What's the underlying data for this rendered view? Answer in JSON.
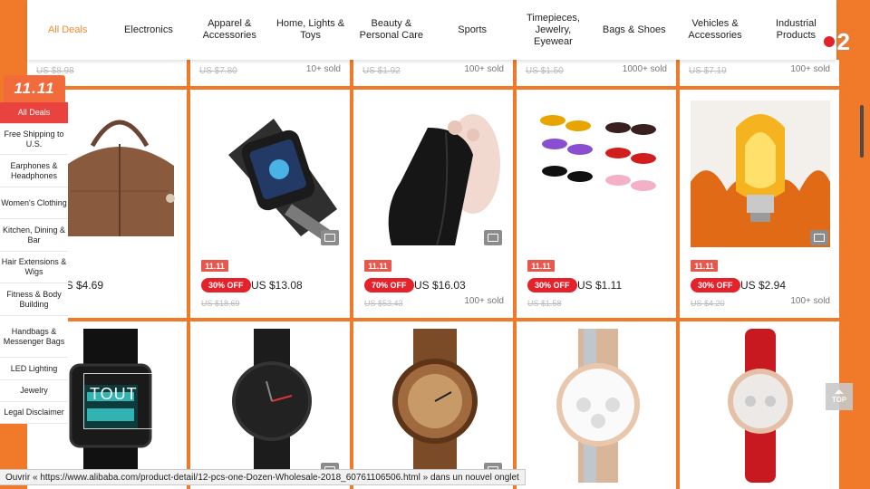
{
  "nav": {
    "items": [
      {
        "label": "All Deals",
        "active": true
      },
      {
        "label": "Electronics"
      },
      {
        "label": "Apparel & Accessories"
      },
      {
        "label": "Home, Lights & Toys"
      },
      {
        "label": "Beauty & Personal Care"
      },
      {
        "label": "Sports"
      },
      {
        "label": "Timepieces, Jewelry, Eyewear"
      },
      {
        "label": "Bags & Shoes"
      },
      {
        "label": "Vehicles & Accessories"
      },
      {
        "label": "Industrial Products"
      }
    ]
  },
  "live_badge": {
    "number": "2",
    "dot_color": "#e4222b"
  },
  "sidebar": {
    "logo": "11.11",
    "items": [
      {
        "label": "All Deals",
        "active": true
      },
      {
        "label": "Free Shipping to U.S."
      },
      {
        "label": "Earphones & Headphones"
      },
      {
        "label": "Women's Clothing"
      },
      {
        "label": "Kitchen, Dining & Bar"
      },
      {
        "label": "Hair Extensions & Wigs"
      },
      {
        "label": "Fitness & Body Building"
      },
      {
        "label": "Handbags & Messenger Bags"
      },
      {
        "label": "LED Lighting"
      },
      {
        "label": "Jewelry"
      },
      {
        "label": "Legal Disclaimer"
      }
    ]
  },
  "top_strip": [
    {
      "old_price": "US $8.98",
      "sold": ""
    },
    {
      "old_price": "US $7.80",
      "sold": "10+ sold"
    },
    {
      "old_price": "US $1.92",
      "sold": "100+ sold"
    },
    {
      "old_price": "US $1.50",
      "sold": "1000+ sold"
    },
    {
      "old_price": "US $7.19",
      "sold": "100+ sold"
    }
  ],
  "products_row1": [
    {
      "name": "brown-handbag",
      "promo": "11.11",
      "discount": "",
      "price": "US $4.69",
      "old_price": "",
      "sold": "",
      "video": false
    },
    {
      "name": "smart-watch",
      "promo": "11.11",
      "discount": "30% OFF",
      "price": "US $13.08",
      "old_price": "US $18.69",
      "sold": "",
      "video": true
    },
    {
      "name": "hair-bundles",
      "promo": "11.11",
      "discount": "70% OFF",
      "price": "US $16.03",
      "old_price": "US $53.43",
      "sold": "100+ sold",
      "video": true
    },
    {
      "name": "sunglasses",
      "promo": "11.11",
      "discount": "30% OFF",
      "price": "US $1.11",
      "old_price": "US $1.58",
      "sold": "",
      "video": false
    },
    {
      "name": "flame-bulb",
      "promo": "11.11",
      "discount": "30% OFF",
      "price": "US $2.94",
      "old_price": "US $4.20",
      "sold": "100+ sold",
      "video": true
    }
  ],
  "products_row2": [
    {
      "name": "digital-watch"
    },
    {
      "name": "black-watch"
    },
    {
      "name": "wooden-watch"
    },
    {
      "name": "chronograph-watch"
    },
    {
      "name": "red-strap-watch"
    }
  ],
  "overlay": {
    "tout_text": "TOUT"
  },
  "top_button": {
    "label": "TOP"
  },
  "status_bar": {
    "text": "Ouvrir « https://www.alibaba.com/product-detail/12-pcs-one-Dozen-Wholesale-2018_60761106506.html » dans un nouvel onglet"
  },
  "colors": {
    "accent": "#f07a2a",
    "deal_red": "#e4222b",
    "nav_active": "#f28a2e"
  }
}
